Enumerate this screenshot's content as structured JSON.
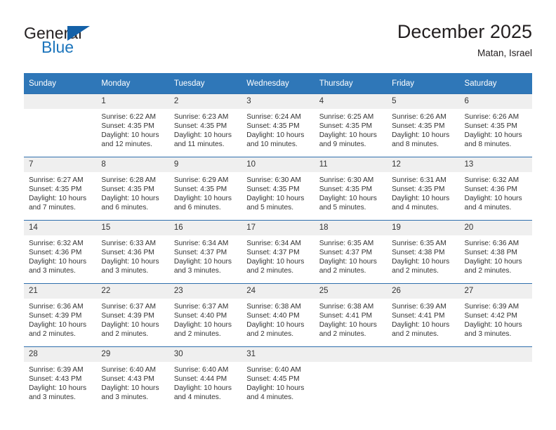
{
  "brand": {
    "name_part1": "General",
    "name_part2": "Blue",
    "accent_color": "#1c75bc",
    "triangle_color": "#1461a8"
  },
  "header": {
    "month_title": "December 2025",
    "location": "Matan, Israel"
  },
  "calendar": {
    "header_bg": "#2f77b8",
    "daynum_bg": "#efefef",
    "weekday_headers": [
      "Sunday",
      "Monday",
      "Tuesday",
      "Wednesday",
      "Thursday",
      "Friday",
      "Saturday"
    ],
    "weeks": [
      [
        {
          "day": "",
          "empty": true,
          "sunrise": "",
          "sunset": "",
          "daylight_line1": "",
          "daylight_line2": ""
        },
        {
          "day": "1",
          "sunrise": "Sunrise: 6:22 AM",
          "sunset": "Sunset: 4:35 PM",
          "daylight_line1": "Daylight: 10 hours",
          "daylight_line2": "and 12 minutes."
        },
        {
          "day": "2",
          "sunrise": "Sunrise: 6:23 AM",
          "sunset": "Sunset: 4:35 PM",
          "daylight_line1": "Daylight: 10 hours",
          "daylight_line2": "and 11 minutes."
        },
        {
          "day": "3",
          "sunrise": "Sunrise: 6:24 AM",
          "sunset": "Sunset: 4:35 PM",
          "daylight_line1": "Daylight: 10 hours",
          "daylight_line2": "and 10 minutes."
        },
        {
          "day": "4",
          "sunrise": "Sunrise: 6:25 AM",
          "sunset": "Sunset: 4:35 PM",
          "daylight_line1": "Daylight: 10 hours",
          "daylight_line2": "and 9 minutes."
        },
        {
          "day": "5",
          "sunrise": "Sunrise: 6:26 AM",
          "sunset": "Sunset: 4:35 PM",
          "daylight_line1": "Daylight: 10 hours",
          "daylight_line2": "and 8 minutes."
        },
        {
          "day": "6",
          "sunrise": "Sunrise: 6:26 AM",
          "sunset": "Sunset: 4:35 PM",
          "daylight_line1": "Daylight: 10 hours",
          "daylight_line2": "and 8 minutes."
        }
      ],
      [
        {
          "day": "7",
          "sunrise": "Sunrise: 6:27 AM",
          "sunset": "Sunset: 4:35 PM",
          "daylight_line1": "Daylight: 10 hours",
          "daylight_line2": "and 7 minutes."
        },
        {
          "day": "8",
          "sunrise": "Sunrise: 6:28 AM",
          "sunset": "Sunset: 4:35 PM",
          "daylight_line1": "Daylight: 10 hours",
          "daylight_line2": "and 6 minutes."
        },
        {
          "day": "9",
          "sunrise": "Sunrise: 6:29 AM",
          "sunset": "Sunset: 4:35 PM",
          "daylight_line1": "Daylight: 10 hours",
          "daylight_line2": "and 6 minutes."
        },
        {
          "day": "10",
          "sunrise": "Sunrise: 6:30 AM",
          "sunset": "Sunset: 4:35 PM",
          "daylight_line1": "Daylight: 10 hours",
          "daylight_line2": "and 5 minutes."
        },
        {
          "day": "11",
          "sunrise": "Sunrise: 6:30 AM",
          "sunset": "Sunset: 4:35 PM",
          "daylight_line1": "Daylight: 10 hours",
          "daylight_line2": "and 5 minutes."
        },
        {
          "day": "12",
          "sunrise": "Sunrise: 6:31 AM",
          "sunset": "Sunset: 4:35 PM",
          "daylight_line1": "Daylight: 10 hours",
          "daylight_line2": "and 4 minutes."
        },
        {
          "day": "13",
          "sunrise": "Sunrise: 6:32 AM",
          "sunset": "Sunset: 4:36 PM",
          "daylight_line1": "Daylight: 10 hours",
          "daylight_line2": "and 4 minutes."
        }
      ],
      [
        {
          "day": "14",
          "sunrise": "Sunrise: 6:32 AM",
          "sunset": "Sunset: 4:36 PM",
          "daylight_line1": "Daylight: 10 hours",
          "daylight_line2": "and 3 minutes."
        },
        {
          "day": "15",
          "sunrise": "Sunrise: 6:33 AM",
          "sunset": "Sunset: 4:36 PM",
          "daylight_line1": "Daylight: 10 hours",
          "daylight_line2": "and 3 minutes."
        },
        {
          "day": "16",
          "sunrise": "Sunrise: 6:34 AM",
          "sunset": "Sunset: 4:37 PM",
          "daylight_line1": "Daylight: 10 hours",
          "daylight_line2": "and 3 minutes."
        },
        {
          "day": "17",
          "sunrise": "Sunrise: 6:34 AM",
          "sunset": "Sunset: 4:37 PM",
          "daylight_line1": "Daylight: 10 hours",
          "daylight_line2": "and 2 minutes."
        },
        {
          "day": "18",
          "sunrise": "Sunrise: 6:35 AM",
          "sunset": "Sunset: 4:37 PM",
          "daylight_line1": "Daylight: 10 hours",
          "daylight_line2": "and 2 minutes."
        },
        {
          "day": "19",
          "sunrise": "Sunrise: 6:35 AM",
          "sunset": "Sunset: 4:38 PM",
          "daylight_line1": "Daylight: 10 hours",
          "daylight_line2": "and 2 minutes."
        },
        {
          "day": "20",
          "sunrise": "Sunrise: 6:36 AM",
          "sunset": "Sunset: 4:38 PM",
          "daylight_line1": "Daylight: 10 hours",
          "daylight_line2": "and 2 minutes."
        }
      ],
      [
        {
          "day": "21",
          "sunrise": "Sunrise: 6:36 AM",
          "sunset": "Sunset: 4:39 PM",
          "daylight_line1": "Daylight: 10 hours",
          "daylight_line2": "and 2 minutes."
        },
        {
          "day": "22",
          "sunrise": "Sunrise: 6:37 AM",
          "sunset": "Sunset: 4:39 PM",
          "daylight_line1": "Daylight: 10 hours",
          "daylight_line2": "and 2 minutes."
        },
        {
          "day": "23",
          "sunrise": "Sunrise: 6:37 AM",
          "sunset": "Sunset: 4:40 PM",
          "daylight_line1": "Daylight: 10 hours",
          "daylight_line2": "and 2 minutes."
        },
        {
          "day": "24",
          "sunrise": "Sunrise: 6:38 AM",
          "sunset": "Sunset: 4:40 PM",
          "daylight_line1": "Daylight: 10 hours",
          "daylight_line2": "and 2 minutes."
        },
        {
          "day": "25",
          "sunrise": "Sunrise: 6:38 AM",
          "sunset": "Sunset: 4:41 PM",
          "daylight_line1": "Daylight: 10 hours",
          "daylight_line2": "and 2 minutes."
        },
        {
          "day": "26",
          "sunrise": "Sunrise: 6:39 AM",
          "sunset": "Sunset: 4:41 PM",
          "daylight_line1": "Daylight: 10 hours",
          "daylight_line2": "and 2 minutes."
        },
        {
          "day": "27",
          "sunrise": "Sunrise: 6:39 AM",
          "sunset": "Sunset: 4:42 PM",
          "daylight_line1": "Daylight: 10 hours",
          "daylight_line2": "and 3 minutes."
        }
      ],
      [
        {
          "day": "28",
          "sunrise": "Sunrise: 6:39 AM",
          "sunset": "Sunset: 4:43 PM",
          "daylight_line1": "Daylight: 10 hours",
          "daylight_line2": "and 3 minutes."
        },
        {
          "day": "29",
          "sunrise": "Sunrise: 6:40 AM",
          "sunset": "Sunset: 4:43 PM",
          "daylight_line1": "Daylight: 10 hours",
          "daylight_line2": "and 3 minutes."
        },
        {
          "day": "30",
          "sunrise": "Sunrise: 6:40 AM",
          "sunset": "Sunset: 4:44 PM",
          "daylight_line1": "Daylight: 10 hours",
          "daylight_line2": "and 4 minutes."
        },
        {
          "day": "31",
          "sunrise": "Sunrise: 6:40 AM",
          "sunset": "Sunset: 4:45 PM",
          "daylight_line1": "Daylight: 10 hours",
          "daylight_line2": "and 4 minutes."
        },
        {
          "day": "",
          "empty": true,
          "sunrise": "",
          "sunset": "",
          "daylight_line1": "",
          "daylight_line2": ""
        },
        {
          "day": "",
          "empty": true,
          "sunrise": "",
          "sunset": "",
          "daylight_line1": "",
          "daylight_line2": ""
        },
        {
          "day": "",
          "empty": true,
          "sunrise": "",
          "sunset": "",
          "daylight_line1": "",
          "daylight_line2": ""
        }
      ]
    ]
  }
}
